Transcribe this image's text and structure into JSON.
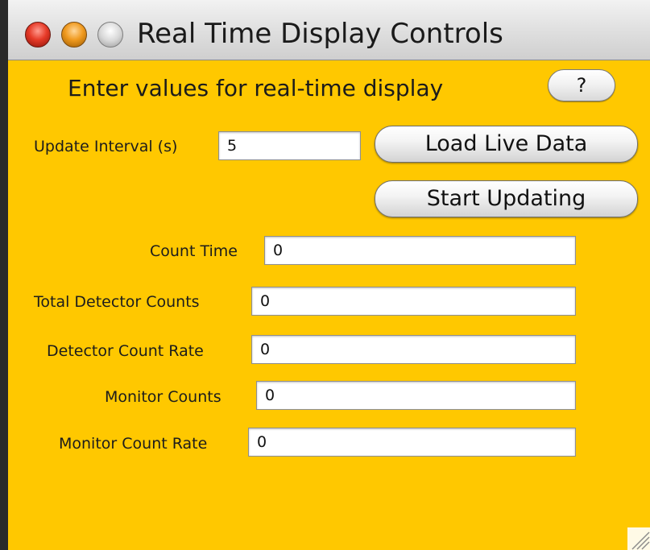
{
  "window": {
    "title": "Real Time Display Controls",
    "background_color": "#ffc800",
    "controls": [
      "close-icon",
      "minimize-icon",
      "zoom-icon"
    ]
  },
  "header": {
    "heading": "Enter values for real-time display",
    "help_label": "?"
  },
  "update": {
    "label": "Update Interval (s)",
    "value": "5"
  },
  "buttons": {
    "load_live_data": "Load Live Data",
    "start_updating": "Start Updating"
  },
  "fields": [
    {
      "label": "Count Time",
      "value": "0"
    },
    {
      "label": "Total Detector Counts",
      "value": "0"
    },
    {
      "label": "Detector Count Rate",
      "value": "0"
    },
    {
      "label": "Monitor Counts",
      "value": "0"
    },
    {
      "label": "Monitor Count Rate",
      "value": "0"
    }
  ]
}
